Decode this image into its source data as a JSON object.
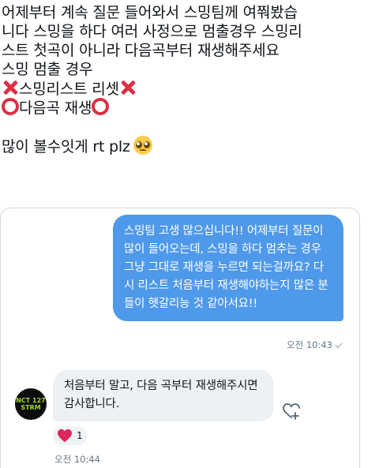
{
  "tweet": {
    "line1": "어제부터 계속 질문 들어와서 스밍팀께 여쭤봤습",
    "line2": "니다 스밍을 하다 여러 사정으로 멈출경우 스밍리",
    "line3": "스트 첫곡이 아니라 다음곡부터 재생해주세요",
    "line4": "스밍 멈출 경우",
    "line5": "스밍리스트 리셋",
    "line6": "다음곡 재생",
    "line8": "많이 볼수잇게 rt plz",
    "emoji_x": "cross-mark-emoji",
    "emoji_o": "hollow-red-circle-emoji",
    "emoji_plead": "pleading-face-emoji"
  },
  "dm": {
    "sent_message": "스밍팀 고생 많으십니다!! 어제부터 질문이 많이 들어오는데, 스밍을 하다 멈추는 경우 그냥 그대로 재생을 누르면 되는걸까요? 다시 리스트 처음부터 재생해야하는지 많은 분들이 헷갈리능 것 같아서요!!",
    "sent_time": "오전 10:43",
    "received_message": "처음부터 말고, 다음 곡부터 재생해주시면 감사합니다.",
    "received_time": "오전 10:44",
    "avatar_text": "NCT 127 STRM",
    "reaction_count": "1",
    "colors": {
      "sent_bubble": "#4f99ea",
      "received_bubble": "#eef1f3",
      "heart": "#e0245e"
    }
  }
}
